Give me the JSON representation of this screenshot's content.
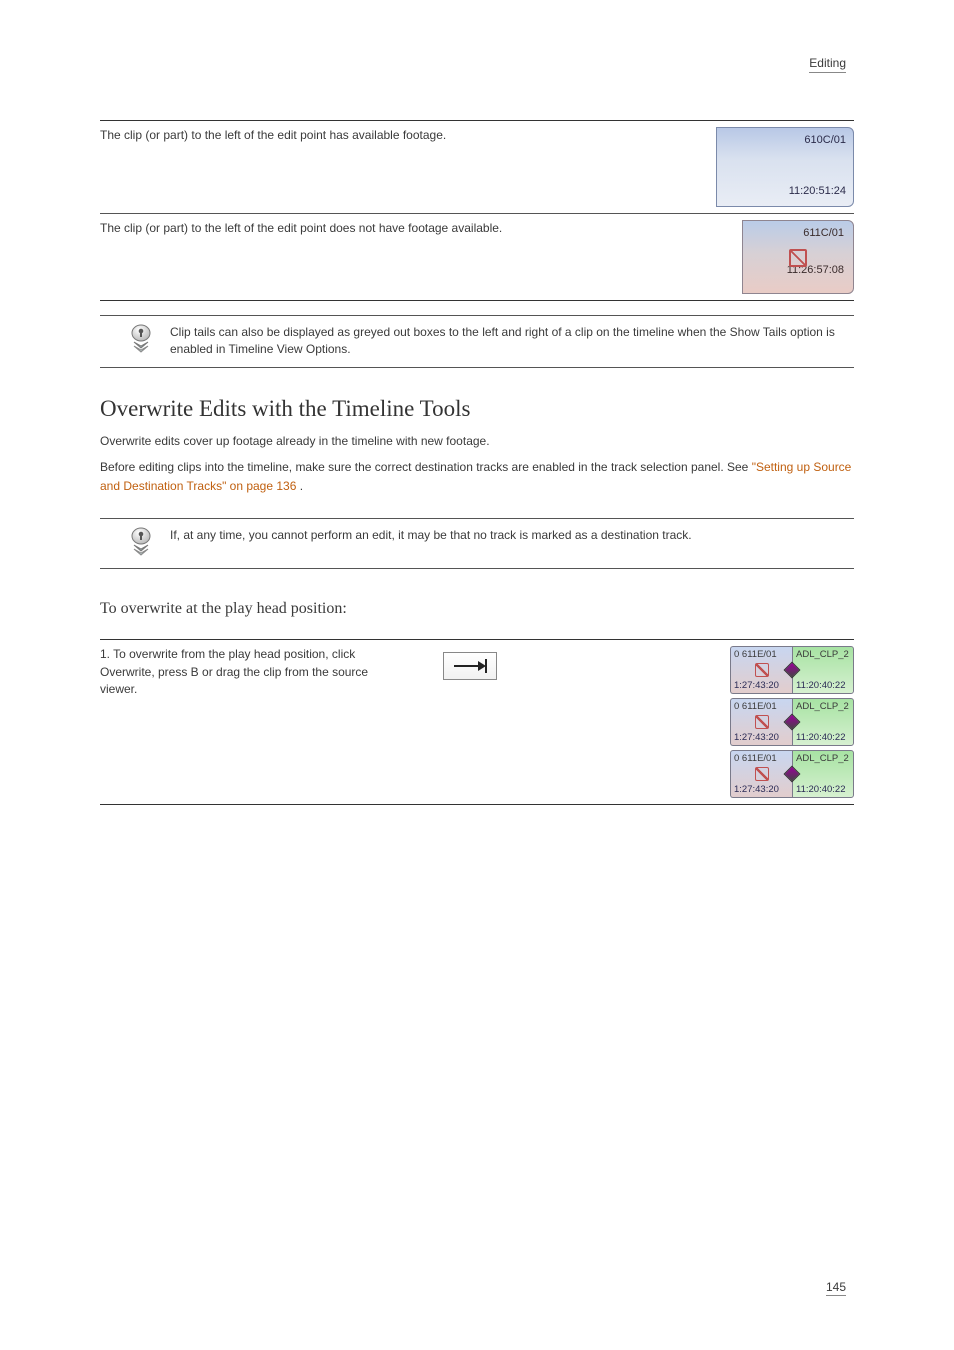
{
  "header": {
    "section_label": "Editing"
  },
  "table1": {
    "row1": {
      "text": "The clip (or part) to the left of the edit point has available footage.",
      "clip": {
        "name": "610C/01",
        "tc": "11:20:51:24"
      }
    },
    "row2": {
      "text": "The clip (or part) to the left of the edit point does not have footage available.",
      "clip": {
        "name": "611C/01",
        "tc": "11:26:57:08"
      }
    },
    "tip": "Clip tails can also be displayed as greyed out boxes to the left and right of a clip on the timeline when the Show Tails option is enabled in Timeline View Options."
  },
  "section": {
    "title": "Overwrite Edits with the Timeline Tools",
    "para1": "Overwrite edits cover up footage already in the timeline with new footage.",
    "para2_a": "Before editing clips into the timeline, make sure the correct destination tracks are enabled in the track selection panel. See ",
    "para2_link": "\"Setting up Source and Destination Tracks\" on page 136",
    "para2_b": ".",
    "tip2": "If, at any time, you cannot perform an edit, it may be that no track is marked as a destination track."
  },
  "heading2": "To overwrite at the play head position:",
  "bottom": {
    "steps": "1. To overwrite from the play head position, click Overwrite, press B or drag the clip from the source viewer.",
    "strip": {
      "a_name": "0  611E/01",
      "a_tc": "1:27:43:20",
      "b_name": "ADL_CLP_2",
      "b_tc": "11:20:40:22"
    }
  },
  "footer": {
    "page": "145"
  },
  "icons": {
    "arrow_alt": "overwrite-icon"
  }
}
